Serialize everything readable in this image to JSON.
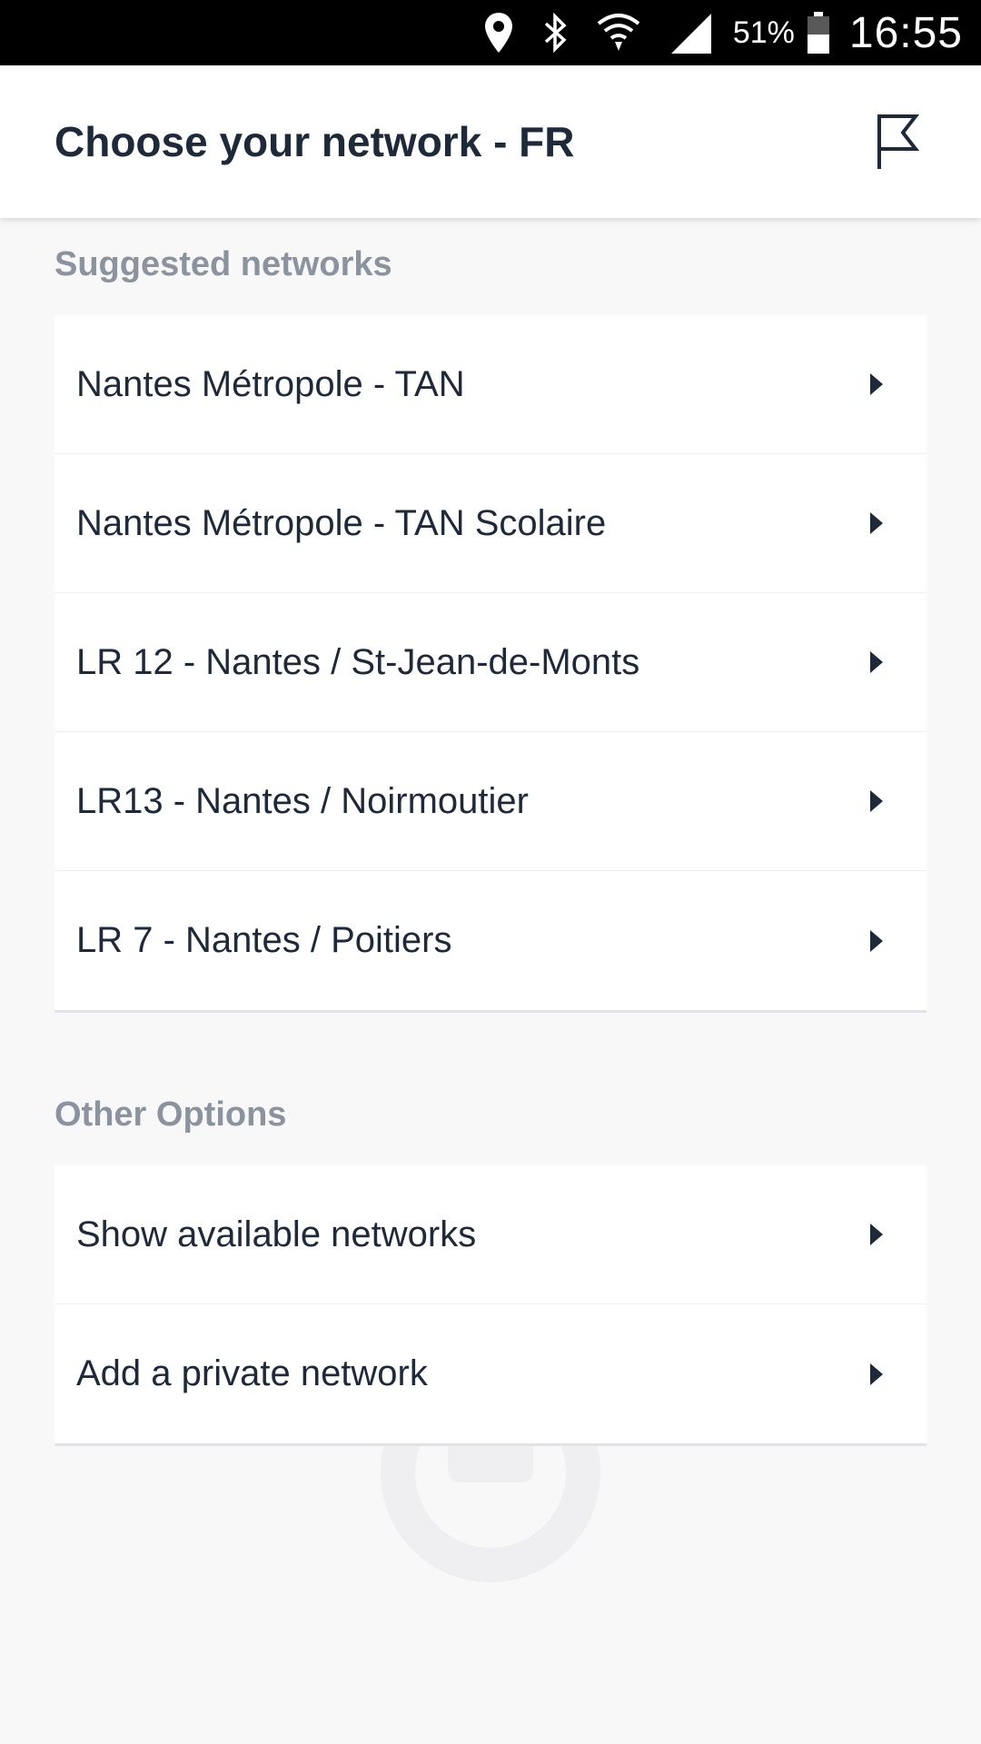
{
  "status_bar": {
    "icons": [
      "location-icon",
      "bluetooth-icon",
      "wifi-icon",
      "signal-icon",
      "battery-icon"
    ],
    "battery_percent": "51%",
    "time": "16:55"
  },
  "app_bar": {
    "title": "Choose your network - FR",
    "action_icon": "flag-icon"
  },
  "sections": {
    "suggested": {
      "title": "Suggested networks",
      "items": [
        {
          "label": "Nantes Métropole - TAN"
        },
        {
          "label": "Nantes Métropole - TAN Scolaire"
        },
        {
          "label": "LR 12 - Nantes / St-Jean-de-Monts"
        },
        {
          "label": "LR13 - Nantes / Noirmoutier"
        },
        {
          "label": "LR 7 - Nantes / Poitiers"
        }
      ]
    },
    "other": {
      "title": "Other Options",
      "items": [
        {
          "label": "Show available networks"
        },
        {
          "label": "Add a private network"
        }
      ]
    }
  },
  "colors": {
    "text_primary": "#1e2a3a",
    "section_header": "#8a939e",
    "background": "#f8f8f8",
    "card": "#ffffff"
  }
}
